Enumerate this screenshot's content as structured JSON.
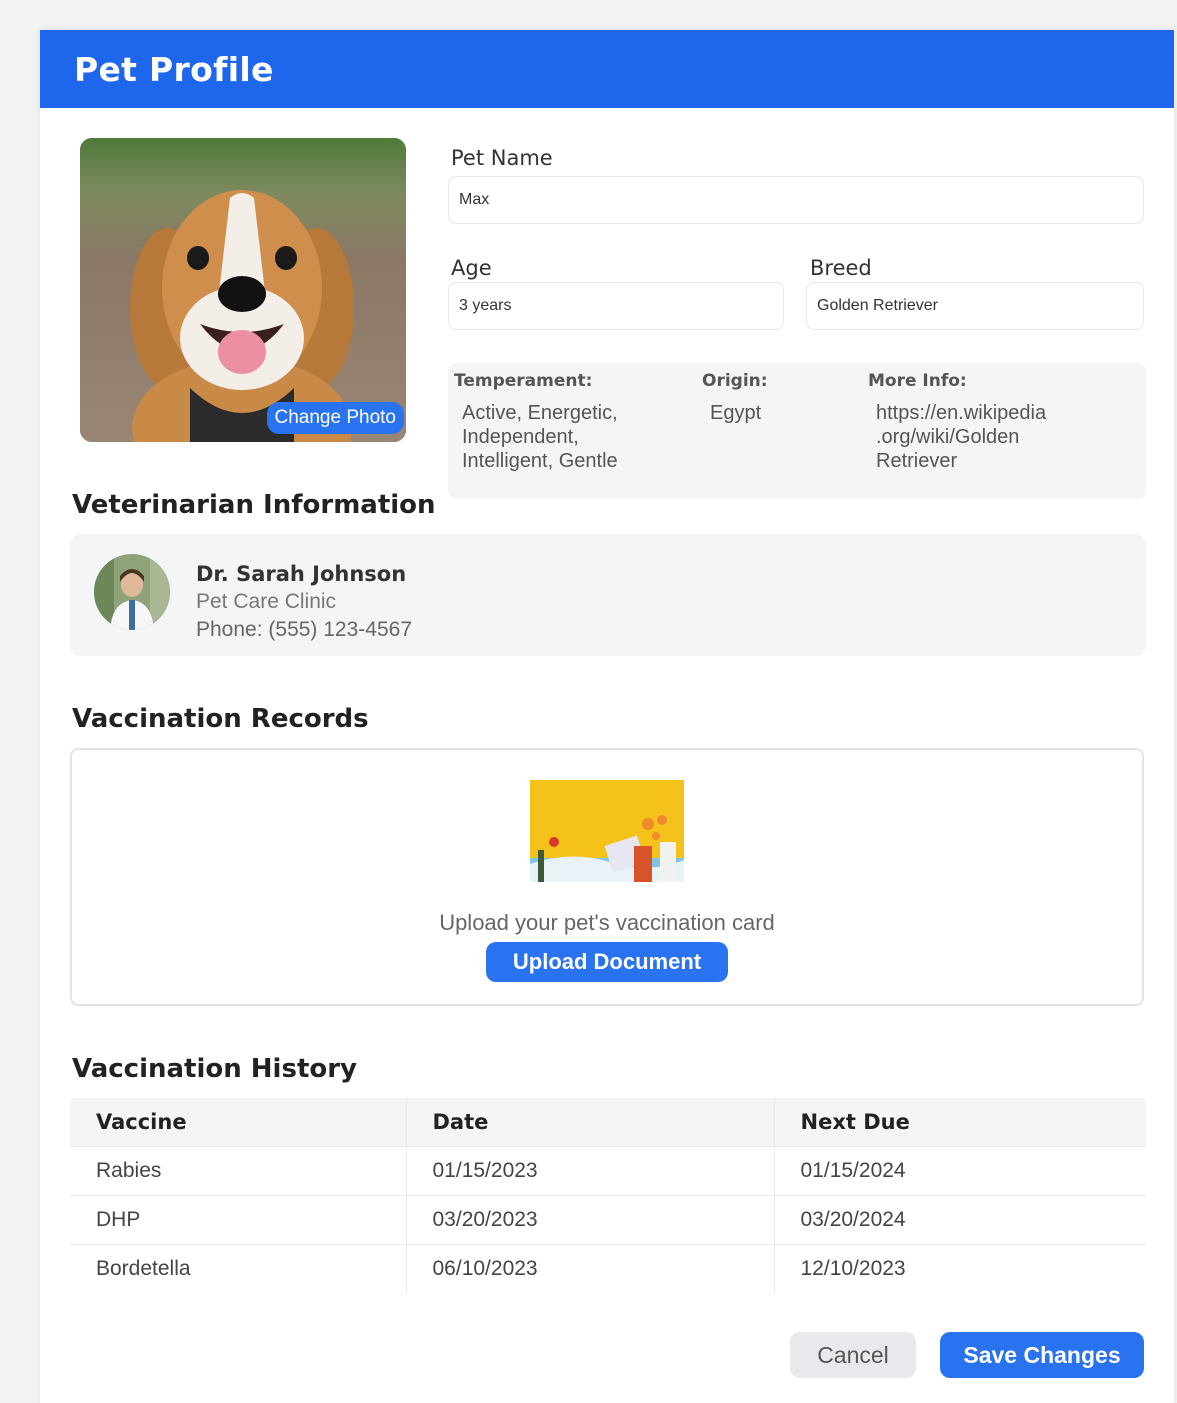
{
  "header": {
    "title": "Pet Profile"
  },
  "photo": {
    "change_label": "Change Photo"
  },
  "form": {
    "pet_name_label": "Pet Name",
    "pet_name_value": "Max",
    "age_label": "Age",
    "age_value": "3 years",
    "breed_label": "Breed",
    "breed_value": "Golden Retriever"
  },
  "breed_info": {
    "temperament_label": "Temperament:",
    "temperament_value": "Active, Energetic,\nIndependent,\nIntelligent, Gentle",
    "origin_label": "Origin:",
    "origin_value": "Egypt",
    "more_info_label": "More Info:",
    "more_info_value": "https://en.wikipedia\n.org/wiki/Golden\nRetriever"
  },
  "veterinarian": {
    "section_title": "Veterinarian Information",
    "name": "Dr. Sarah Johnson",
    "clinic": "Pet Care Clinic",
    "phone": "Phone: (555) 123-4567"
  },
  "vaccination_records": {
    "section_title": "Vaccination Records",
    "upload_text": "Upload your pet's vaccination card",
    "upload_button": "Upload Document"
  },
  "vaccination_history": {
    "section_title": "Vaccination History",
    "columns": [
      "Vaccine",
      "Date",
      "Next Due"
    ],
    "rows": [
      [
        "Rabies",
        "01/15/2023",
        "01/15/2024"
      ],
      [
        "DHP",
        "03/20/2023",
        "03/20/2024"
      ],
      [
        "Bordetella",
        "06/10/2023",
        "12/10/2023"
      ]
    ]
  },
  "actions": {
    "cancel_label": "Cancel",
    "save_label": "Save Changes"
  },
  "colors": {
    "primary": "#1e66ec",
    "button": "#2a73f0",
    "panel_bg": "#f4f5f7"
  }
}
